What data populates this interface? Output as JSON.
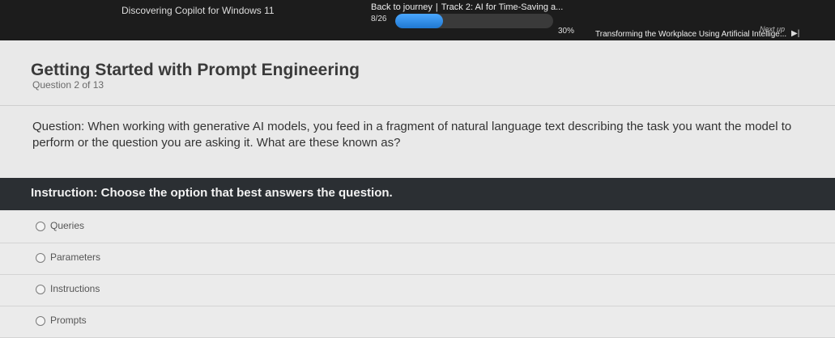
{
  "header": {
    "previous_course": "Discovering Copilot for Windows 11",
    "back_link": "Back to journey",
    "separator": "|",
    "track_title": "Track 2: AI for Time-Saving a...",
    "item_count": "8/26",
    "progress_percent_label": "30%",
    "progress_fraction": 0.3,
    "next_up_label": "Next up",
    "next_up_title": "Transforming the Workplace Using Artificial Intellige...",
    "next_icon": "skip-next-icon"
  },
  "main": {
    "title": "Getting Started with Prompt Engineering",
    "question_count": "Question 2 of 13",
    "question_prefix": "Question:",
    "question_text": "When working with generative AI models, you feed in a fragment of natural language text describing the task you want the model to perform or the question you are asking it. What are these known as?",
    "instruction": "Instruction: Choose the option that best answers the question.",
    "options": [
      "Queries",
      "Parameters",
      "Instructions",
      "Prompts"
    ]
  },
  "colors": {
    "header_bg": "#1c1c1c",
    "progress_accent": "#2f8fe8",
    "instruction_bg": "#2b2f33"
  }
}
